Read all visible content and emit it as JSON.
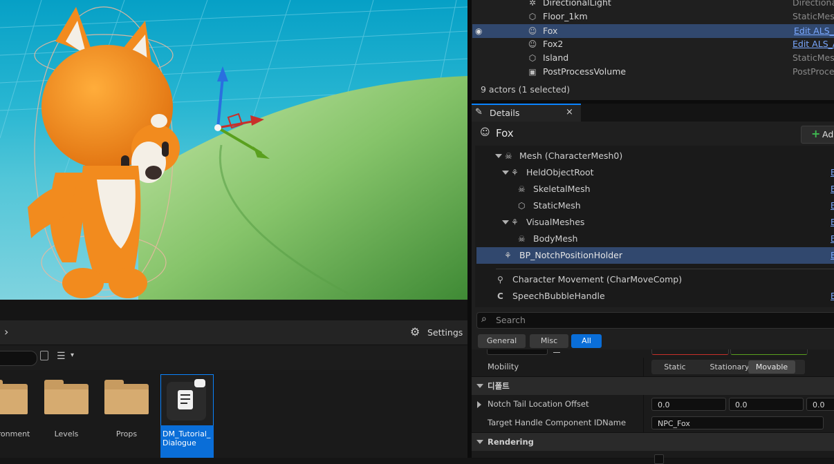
{
  "outliner": {
    "rows": [
      {
        "name": "DirectionalLight",
        "type": "Directiona",
        "icon": "directional-light-icon"
      },
      {
        "name": "Floor_1km",
        "type": "StaticMesl",
        "icon": "static-mesh-icon"
      },
      {
        "name": "Fox",
        "type": "Edit ALS_A",
        "icon": "skeletal-mesh-icon",
        "selected": true
      },
      {
        "name": "Fox2",
        "type": "Edit ALS_A",
        "icon": "skeletal-mesh-icon"
      },
      {
        "name": "Island",
        "type": "StaticMesl",
        "icon": "static-mesh-icon"
      },
      {
        "name": "PostProcessVolume",
        "type": "PostProce",
        "icon": "post-process-icon"
      }
    ],
    "actor_count": "9 actors (1 selected)"
  },
  "details": {
    "tab_label": "Details",
    "actor_name": "Fox",
    "add_label": "Ad",
    "components": [
      {
        "label": "Mesh (CharacterMesh0)"
      },
      {
        "label": "HeldObjectRoot"
      },
      {
        "label": "SkeletalMesh"
      },
      {
        "label": "StaticMesh"
      },
      {
        "label": "VisualMeshes"
      },
      {
        "label": "BodyMesh"
      },
      {
        "label": "BP_NotchPositionHolder"
      },
      {
        "label": "Character Movement (CharMoveComp)"
      },
      {
        "label": "SpeechBubbleHandle"
      }
    ],
    "search_placeholder": "Search",
    "filters": [
      "General",
      "Misc",
      "All"
    ],
    "mobility": {
      "label": "Mobility",
      "options": [
        "Static",
        "Stationary",
        "Movable"
      ],
      "selected": "Movable"
    },
    "category_default": "디폴트",
    "notch": {
      "label": "Notch Tail Location Offset",
      "x": "0.0",
      "y": "0.0",
      "z": "0.0"
    },
    "target": {
      "label": "Target Handle Component IDName",
      "value": "NPC_Fox"
    },
    "category_rendering": "Rendering"
  },
  "content_browser": {
    "settings_label": "Settings",
    "items": [
      {
        "label": "ronment",
        "kind": "folder"
      },
      {
        "label": "Levels",
        "kind": "folder"
      },
      {
        "label": "Props",
        "kind": "folder"
      },
      {
        "label": "DM_Tutorial_\nDialogue",
        "kind": "asset",
        "selected": true
      }
    ]
  },
  "colors": {
    "selection": "#31486e",
    "accent": "#0a84ff",
    "link": "#7aa8ff",
    "fox": "#f28b1e"
  }
}
